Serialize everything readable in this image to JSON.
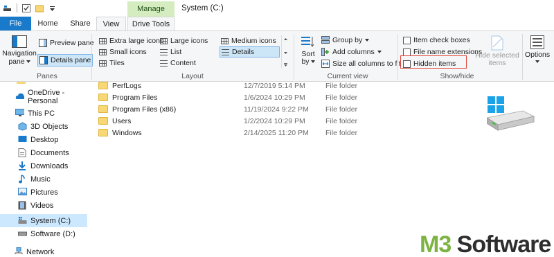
{
  "title_bar": {
    "manage_label": "Manage",
    "window_title": "System (C:)"
  },
  "tabs": {
    "file": "File",
    "home": "Home",
    "share": "Share",
    "view": "View",
    "drive_tools": "Drive Tools"
  },
  "ribbon": {
    "panes": {
      "navigation_pane": "Navigation",
      "navigation_pane_2": "pane",
      "preview_pane": "Preview pane",
      "details_pane": "Details pane",
      "group": "Panes"
    },
    "layout": {
      "extra_large_icons": "Extra large icons",
      "large_icons": "Large icons",
      "medium_icons": "Medium icons",
      "small_icons": "Small icons",
      "list": "List",
      "details": "Details",
      "tiles": "Tiles",
      "content": "Content",
      "group": "Layout"
    },
    "current_view": {
      "sort_by": "Sort",
      "sort_by_2": "by",
      "group_by": "Group by",
      "add_columns": "Add columns",
      "size_all_columns": "Size all columns to fit",
      "group": "Current view"
    },
    "show_hide": {
      "item_check_boxes": "Item check boxes",
      "file_name_extensions": "File name extensions",
      "hidden_items": "Hidden items",
      "hide_selected": "Hide selected",
      "hide_selected_2": "items",
      "group": "Show/hide"
    },
    "options": "Options"
  },
  "nav": [
    {
      "label": "OneDrive - Personal",
      "icon": "cloud-icon"
    },
    {
      "label": "This PC",
      "icon": "computer-icon"
    },
    {
      "label": "3D Objects",
      "icon": "cube-icon"
    },
    {
      "label": "Desktop",
      "icon": "desktop-icon"
    },
    {
      "label": "Documents",
      "icon": "documents-icon"
    },
    {
      "label": "Downloads",
      "icon": "download-icon"
    },
    {
      "label": "Music",
      "icon": "music-icon"
    },
    {
      "label": "Pictures",
      "icon": "pictures-icon"
    },
    {
      "label": "Videos",
      "icon": "video-icon"
    },
    {
      "label": "System (C:)",
      "icon": "system-drive-icon"
    },
    {
      "label": "Software (D:)",
      "icon": "drive-icon"
    },
    {
      "label": "Network",
      "icon": "network-icon"
    }
  ],
  "files": [
    {
      "name": "PerfLogs",
      "date": "12/7/2019 5:14 PM",
      "type": "File folder"
    },
    {
      "name": "Program Files",
      "date": "1/6/2024 10:29 PM",
      "type": "File folder"
    },
    {
      "name": "Program Files (x86)",
      "date": "11/19/2024 9:22 PM",
      "type": "File folder"
    },
    {
      "name": "Users",
      "date": "1/2/2024 10:29 PM",
      "type": "File folder"
    },
    {
      "name": "Windows",
      "date": "2/14/2025 11:20 PM",
      "type": "File folder"
    }
  ],
  "watermark": {
    "m3": "M3",
    "software": " Software"
  },
  "colors": {
    "accent": "#1979ca",
    "manage_tab": "#d4ecc0",
    "highlight_box": "#e0493e",
    "selection": "#cce8ff",
    "folder": "#f8d775"
  }
}
